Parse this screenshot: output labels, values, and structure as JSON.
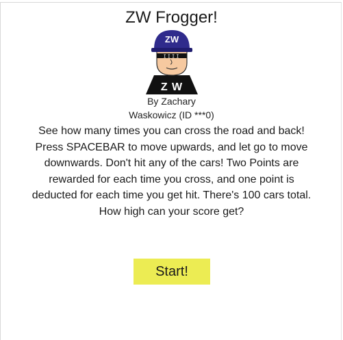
{
  "game": {
    "title": "ZW Frogger!",
    "logo": {
      "cap_text": "ZW",
      "glasses_text": "IIII",
      "shirt_text": "Z W",
      "colors": {
        "cap": "#2f2b8c",
        "skin": "#f6c9a0",
        "shirt": "#111111",
        "shirt_text": "#ffffff"
      }
    },
    "byline": {
      "line1": "By Zachary",
      "line2": "Waskowicz (ID ***0)"
    },
    "instructions": [
      "See how many times you can cross the road and back!",
      "Press SPACEBAR to move upwards, and let go to move",
      "downwards.  Don't hit any of the cars!  Two Points are",
      "rewarded for each time you cross, and one point is",
      "deducted for each time you get hit.  There's 100 cars total.",
      "How high can your score get?"
    ],
    "start_button": {
      "label": "Start!",
      "color": "#ecec53"
    }
  }
}
